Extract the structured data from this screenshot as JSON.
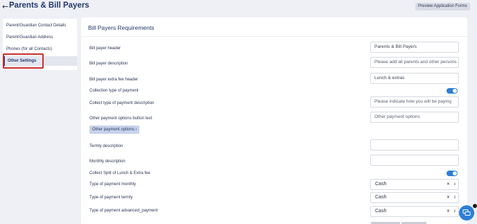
{
  "header": {
    "title": "Parents & Bill Payers",
    "preview_label": "Preview Application Forms"
  },
  "sidebar": {
    "items": [
      {
        "label": "Parent/Guardian Contact Details"
      },
      {
        "label": "Parent/Guardian Address"
      },
      {
        "label": "Phones (for all Contacts)"
      },
      {
        "label": "Other Settings"
      }
    ]
  },
  "main": {
    "title": "Bill Payers Requirements",
    "fields": {
      "header_label": "Bill payer header",
      "header_value": "Parents & Bill Payers",
      "desc_label": "Bill payer description",
      "desc_value": "Please add all parents and other persons",
      "extra_label": "Bill payer extra fee header",
      "extra_value": "Lunch & extras",
      "collection_label": "Collection type of payment",
      "collect_desc_label": "Collect type of payment description",
      "collect_desc_value": "Please indicate how you will be paying",
      "other_label": "Other payment options button text",
      "other_value": "Other payment options",
      "other_button": "Other payment options",
      "termly_label": "Termly description",
      "termly_value": "",
      "monthly_label": "Monthly description",
      "monthly_value": "",
      "split_label": "Collect Split of Lunch & Extra fee",
      "pm_label": "Type of payment monthly",
      "pm_value": "Cash",
      "pt_label": "Type of payment termly",
      "pt_value": "Cash",
      "pa_label": "Type of payment advanced_payment",
      "pa_value": "Cash"
    },
    "toggles": {
      "collection": true,
      "split": true
    }
  },
  "colors": {
    "accent": "#2d7fd6",
    "highlight": "#c62f2f",
    "title": "#23386b"
  },
  "icons": {
    "back": "arrow-left-icon",
    "chat": "chat-icon",
    "clear": "close-icon",
    "caret": "sort-caret-icon"
  }
}
